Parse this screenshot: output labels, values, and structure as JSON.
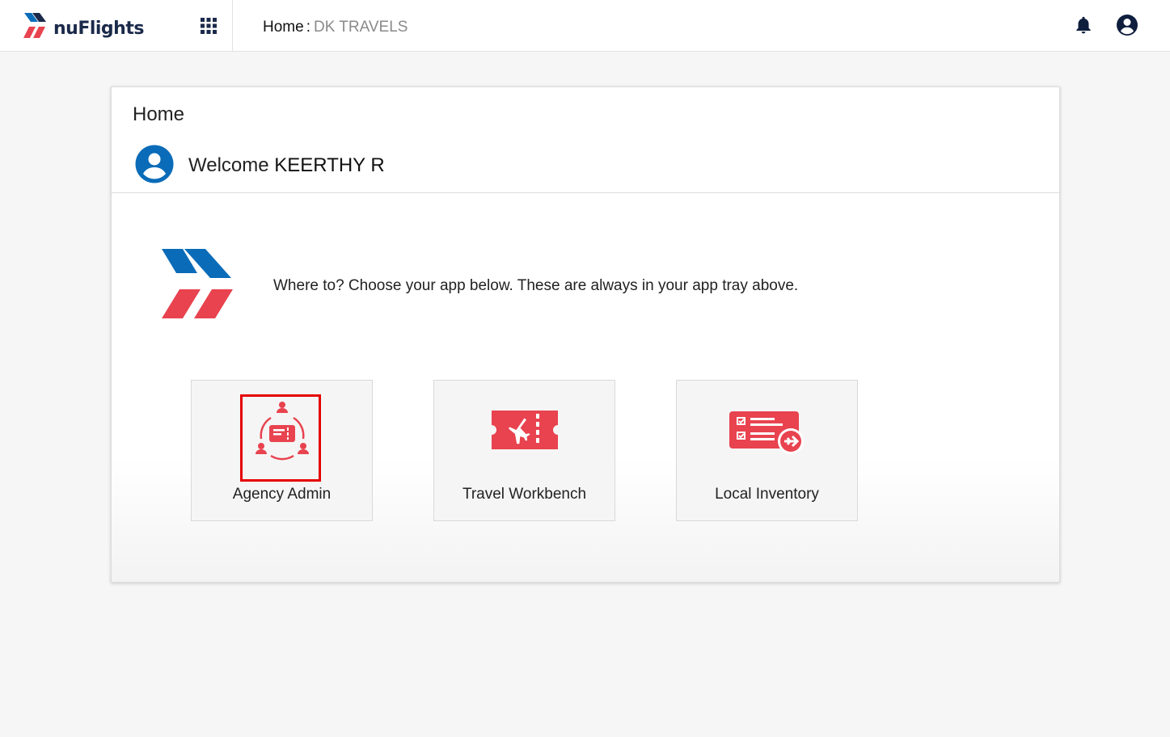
{
  "header": {
    "logo_text": "nuFlights",
    "breadcrumb": {
      "home": "Home",
      "separator": ":",
      "agency": "DK TRAVELS"
    },
    "icons": [
      "apps-grid-icon",
      "bell-icon",
      "user-account-icon"
    ]
  },
  "card": {
    "title": "Home",
    "welcome_prefix": "Welcome",
    "user_name": "KEERTHY R",
    "tagline": "Where to? Choose your app below. These are always in your app tray above."
  },
  "apps": [
    {
      "label": "Agency Admin",
      "icon": "agency-admin-icon",
      "highlighted": true
    },
    {
      "label": "Travel Workbench",
      "icon": "flight-ticket-icon",
      "highlighted": false
    },
    {
      "label": "Local Inventory",
      "icon": "inventory-checklist-icon",
      "highlighted": false
    }
  ],
  "colors": {
    "brand_red": "#e8434f",
    "brand_blue": "#0a6cb8",
    "logo_navy": "#1b2a4a",
    "highlight_red": "#e60000",
    "background": "#f6f6f6"
  }
}
